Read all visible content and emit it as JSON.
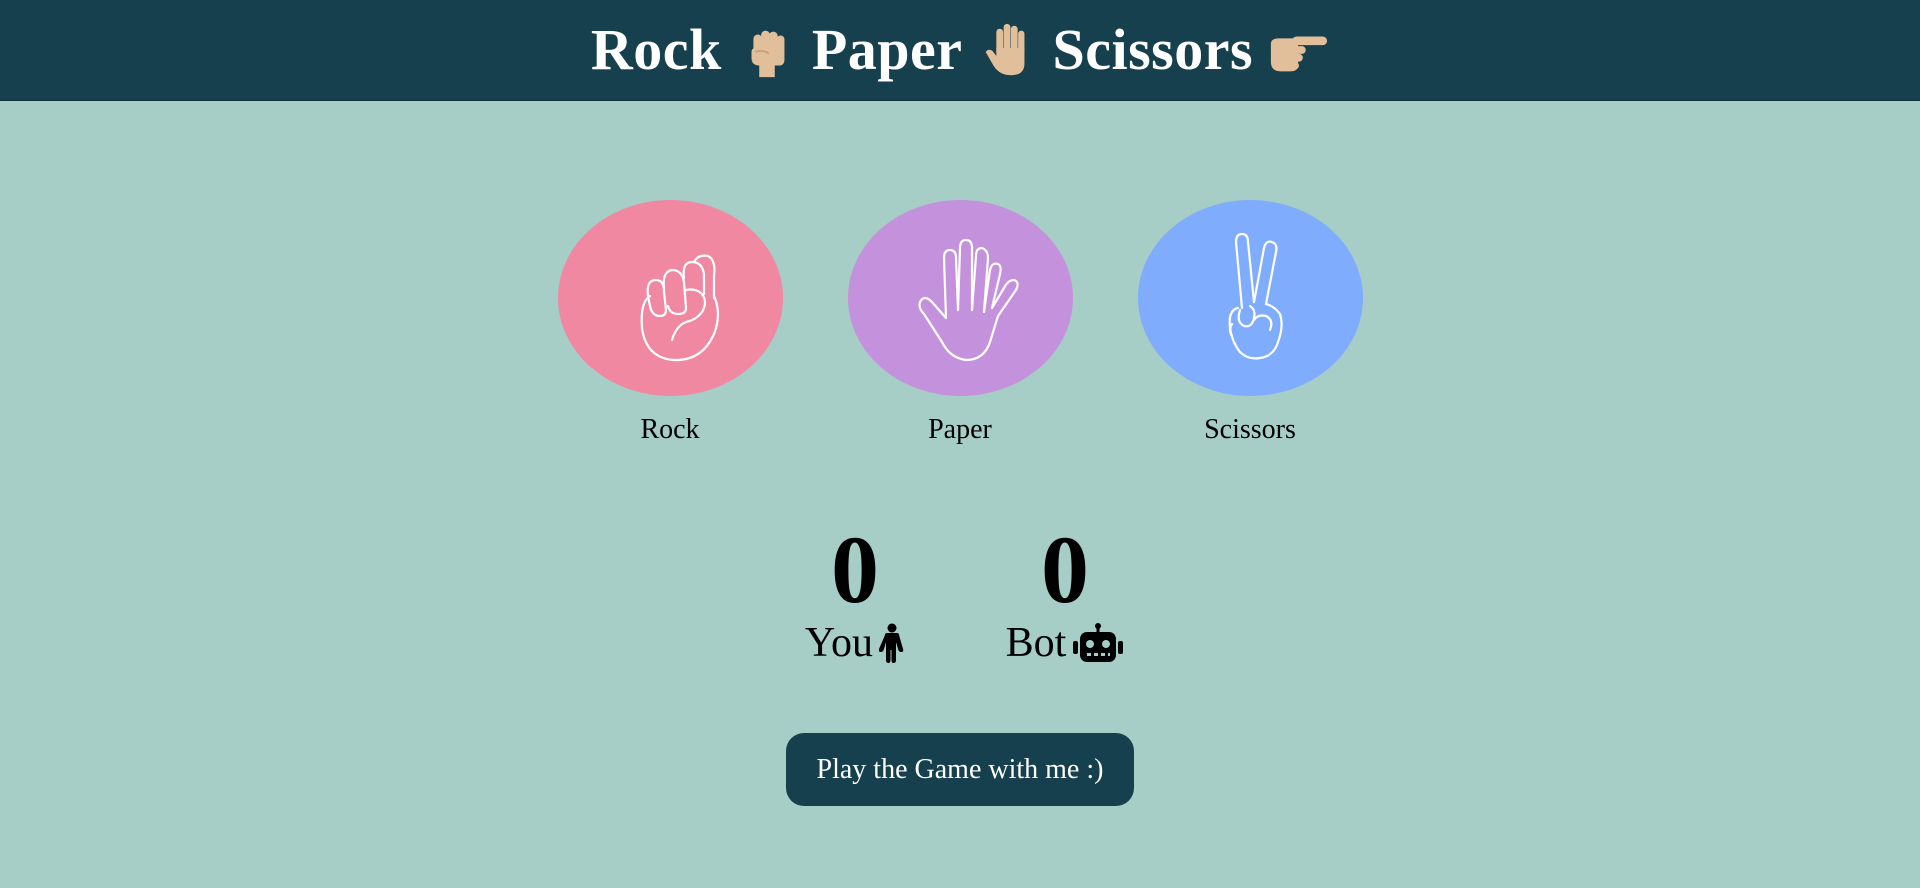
{
  "header": {
    "title_words": [
      "Rock",
      "Paper",
      "Scissors"
    ],
    "emoji_icons": [
      "raised-fist-icon",
      "raised-hand-icon",
      "backhand-index-pointing-right-icon"
    ],
    "background": "#16404d",
    "emoji_color": "#e2bf9b"
  },
  "choices": [
    {
      "label": "Rock",
      "icon": "fist-icon",
      "color": "#f088a2"
    },
    {
      "label": "Paper",
      "icon": "open-hand-icon",
      "color": "#c491dc"
    },
    {
      "label": "Scissors",
      "icon": "victory-hand-icon",
      "color": "#80acfe"
    }
  ],
  "scores": {
    "you": {
      "value": "0",
      "label": "You",
      "icon": "person-icon"
    },
    "bot": {
      "value": "0",
      "label": "Bot",
      "icon": "robot-icon"
    }
  },
  "play_button": {
    "label": "Play the Game with me :)"
  },
  "colors": {
    "page_background": "#a6cdc6",
    "accent": "#16404d"
  }
}
